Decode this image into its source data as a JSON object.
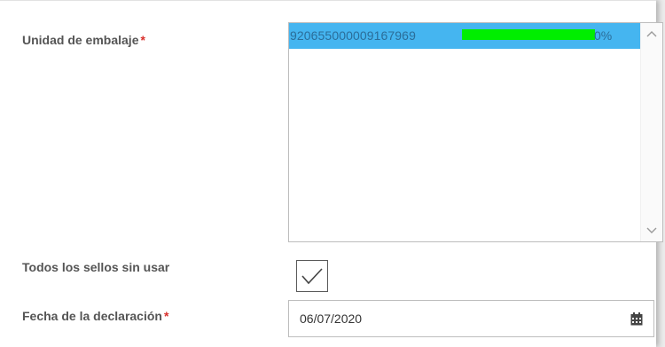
{
  "form": {
    "packaging_unit": {
      "label": "Unidad de embalaje",
      "required_mark": "*",
      "items": [
        {
          "code": "920655000009167969",
          "progress": 0,
          "progress_text": "0%"
        }
      ]
    },
    "unused_seals": {
      "label": "Todos los sellos sin usar",
      "checked": true
    },
    "declaration_date": {
      "label": "Fecha de la declaración",
      "required_mark": "*",
      "value": "06/07/2020"
    }
  },
  "icons": {
    "scroll_up": "chevron-up-icon",
    "scroll_down": "chevron-down-icon",
    "calendar": "calendar-icon",
    "checkmark": "checkmark-icon"
  },
  "colors": {
    "selection": "#45b5f0",
    "progress": "#00ee00",
    "required": "#d9302c",
    "label": "#555555"
  }
}
